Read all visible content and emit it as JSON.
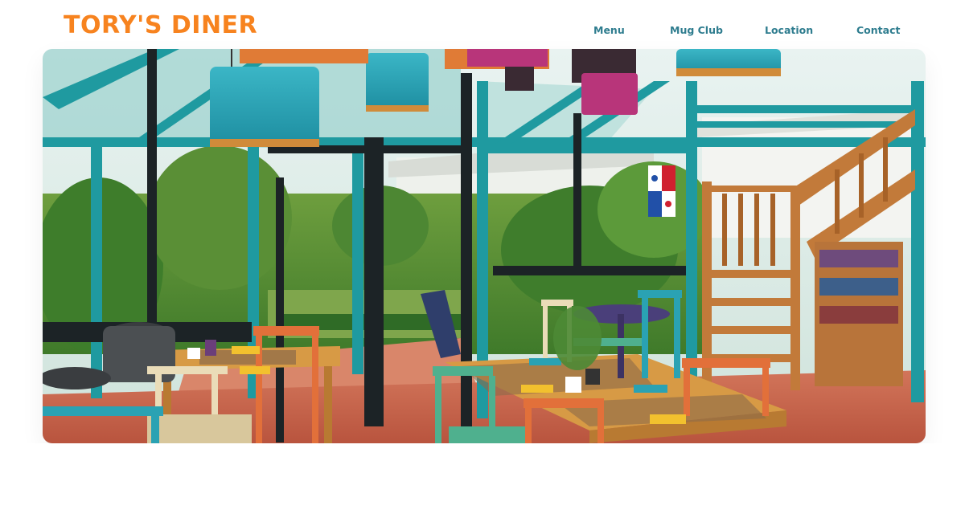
{
  "brand": {
    "name": "TORY'S DINER",
    "color": "#f7831f"
  },
  "nav": {
    "items": [
      {
        "label": "Menu"
      },
      {
        "label": "Mug Club"
      },
      {
        "label": "Location"
      },
      {
        "label": "Contact"
      }
    ],
    "color": "#2f7d8f"
  },
  "hero": {
    "image_subject": "restaurant-interior-photo",
    "slide_count": 2,
    "active_slide": 2
  },
  "colors": {
    "teal_frame": "#1f9aa0",
    "lamp_teal": "#2aa2b3",
    "lamp_magenta": "#b8357a",
    "table_wood": "#d79a45",
    "floor_tile": "#c9644a",
    "stair_wood": "#c27a3a"
  }
}
